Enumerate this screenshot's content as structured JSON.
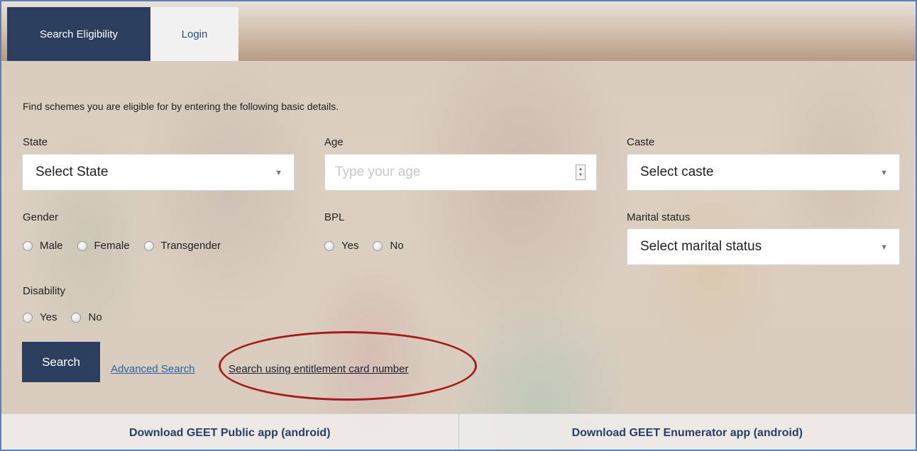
{
  "tabs": {
    "search_eligibility": "Search Eligibility",
    "login": "Login"
  },
  "form": {
    "intro": "Find schemes you are eligible for by entering the following basic details.",
    "state": {
      "label": "State",
      "value": "Select State"
    },
    "age": {
      "label": "Age",
      "placeholder": "Type your age"
    },
    "caste": {
      "label": "Caste",
      "value": "Select caste"
    },
    "gender": {
      "label": "Gender",
      "options": [
        "Male",
        "Female",
        "Transgender"
      ]
    },
    "bpl": {
      "label": "BPL",
      "options": [
        "Yes",
        "No"
      ]
    },
    "marital_status": {
      "label": "Marital status",
      "value": "Select marital status"
    },
    "disability": {
      "label": "Disability",
      "options": [
        "Yes",
        "No"
      ]
    }
  },
  "actions": {
    "search": "Search",
    "advanced_search": "Advanced Search",
    "entitlement_search": "Search using entitlement card number"
  },
  "footer": {
    "public_app": "Download GEET Public app (android)",
    "enumerator_app": "Download GEET Enumerator app (android)"
  },
  "colors": {
    "accent": "#2c3e5e",
    "highlight": "#a71b1b",
    "link": "#2a64a6"
  }
}
